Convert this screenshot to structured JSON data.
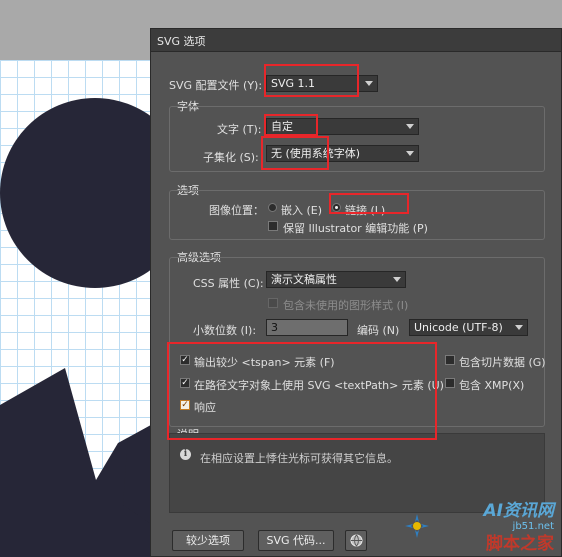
{
  "dialog": {
    "title": "SVG 选项",
    "profile": {
      "label": "SVG 配置文件 (Y):",
      "value": "SVG 1.1"
    },
    "font_section": {
      "title": "字体",
      "type_label": "文字 (T):",
      "type_value": "自定",
      "subset_label": "子集化 (S):",
      "subset_value": "无 (使用系统字体)"
    },
    "options_section": {
      "title": "选项",
      "image_location_label": "图像位置：",
      "embed_label": "嵌入 (E)",
      "link_label": "链接 (L)",
      "preserve_label": "保留 Illustrator 编辑功能 (P)"
    },
    "advanced_section": {
      "title": "高级选项",
      "css_label": "CSS 属性 (C):",
      "css_value": "演示文稿属性",
      "include_unused_label": "包含未使用的图形样式 (I)",
      "decimals_label": "小数位数 (I):",
      "decimals_value": "3",
      "encoding_label": "编码 (N)",
      "encoding_value": "Unicode (UTF-8)",
      "output_fewer_label": "输出较少 <tspan> 元素 (F)",
      "textpath_label": "在路径文字对象上使用 SVG <textPath> 元素 (U)",
      "responsive_label": "响应",
      "include_slicing_label": "包含切片数据 (G)",
      "include_xmp_label": "包含 XMP(X)"
    },
    "description": {
      "title": "说明",
      "text": "在相应设置上悸住光标可获得其它信息。"
    },
    "buttons": {
      "fewer_options": "较少选项",
      "svg_code": "SVG 代码...",
      "web_icon": "globe-icon"
    }
  },
  "watermark": {
    "top": "AI资讯网",
    "net": "jb51.net",
    "bottom": "脚本之家"
  },
  "colors": {
    "highlight": "#e8262a",
    "dialog_bg": "#535353",
    "artwork": "#262637"
  }
}
